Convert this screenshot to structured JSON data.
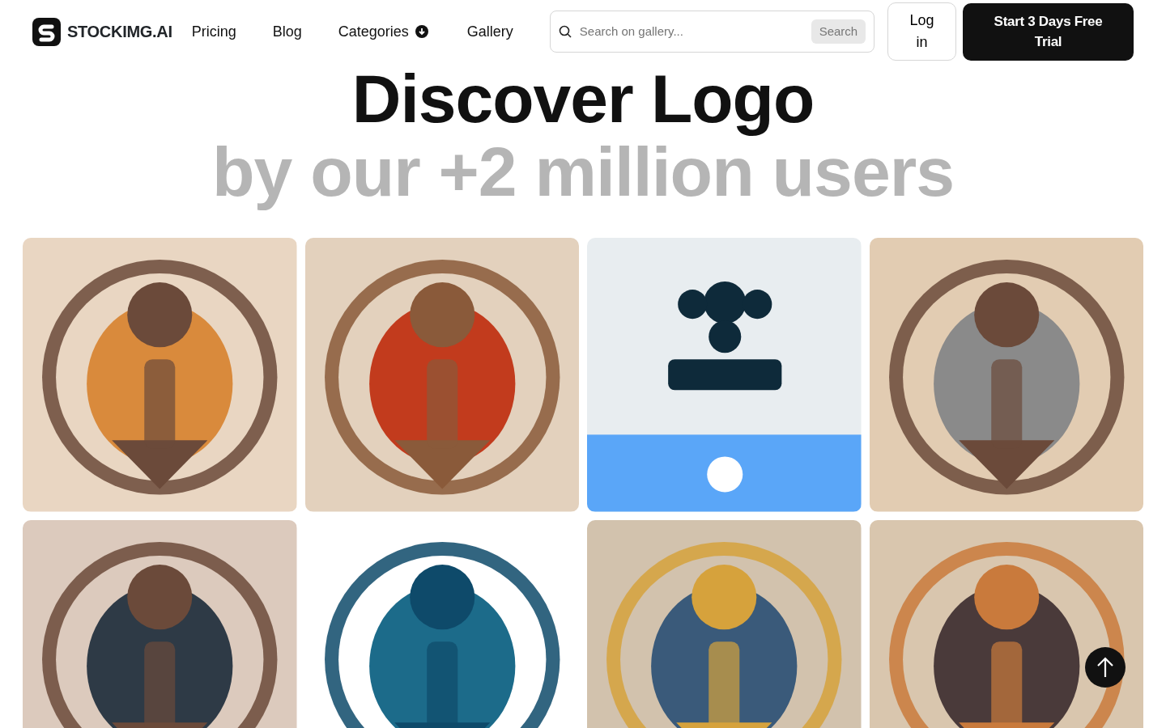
{
  "brand": "STOCKIMG.AI",
  "nav": [
    {
      "label": "Pricing",
      "kind": "link"
    },
    {
      "label": "Blog",
      "kind": "link"
    },
    {
      "label": "Categories",
      "kind": "dropdown"
    },
    {
      "label": "Gallery",
      "kind": "link"
    }
  ],
  "search": {
    "placeholder": "Search on gallery...",
    "button": "Search"
  },
  "login": "Log in",
  "trial": "Start 3 Days Free Trial",
  "hero": {
    "title": "Discover Logo",
    "subtitle": "by our +2 million users"
  }
}
